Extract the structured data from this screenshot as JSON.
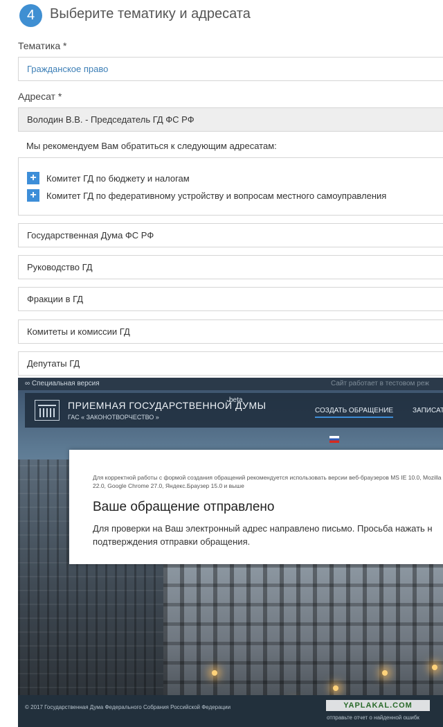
{
  "step": {
    "number": "4",
    "title": "Выберите тематику и адресата"
  },
  "topic": {
    "label": "Тематика *",
    "value": "Гражданское право"
  },
  "addressee": {
    "label": "Адресат *",
    "value": "Володин В.В. - Председатель ГД ФС РФ"
  },
  "recommendations": {
    "text": "Мы рекомендуем Вам обратиться к следующим адресатам:",
    "items": [
      "Комитет ГД по бюджету и налогам",
      "Комитет ГД по федеративному устройству и вопросам местного самоуправления"
    ]
  },
  "groups": [
    "Государственная Дума ФС РФ",
    "Руководство ГД",
    "Фракции в ГД",
    "Комитеты и комиссии ГД",
    "Депутаты ГД"
  ],
  "portal": {
    "special_version": "Специальная версия",
    "test_mode_note": "Сайт работает в тестовом реж",
    "brand_title": "ПРИЕМНАЯ ГОСУДАРСТВЕННОЙ ДУМЫ",
    "brand_sub": "ГАС « ЗАКОНОТВОРЧЕСТВО »",
    "beta": "beta",
    "nav_create": "СОЗДАТЬ ОБРАЩЕНИЕ",
    "nav_write": "ЗАПИСАТ",
    "browser_note": "Для корректной работы с формой создания обращений рекомендуется использовать версии веб-браузеров MS IE 10.0, Mozilla FF 22.0, Google Chrome 27.0, Яндекс.Браузер 15.0 и выше",
    "sent_title": "Ваше обращение отправлено",
    "sent_body": "Для проверки на Ваш электронный адрес направлено письмо. Просьба нажать н подтверждения отправки обращения.",
    "copyright": "© 2017 Государственная Дума Федерального Собрания Российской Федерации",
    "report_error": "отправьте отчет о найденной ошибк",
    "watermark": "YAPLAKAL.COM"
  },
  "colors": {
    "accent": "#3f8fd2",
    "link": "#3d7fb6"
  }
}
